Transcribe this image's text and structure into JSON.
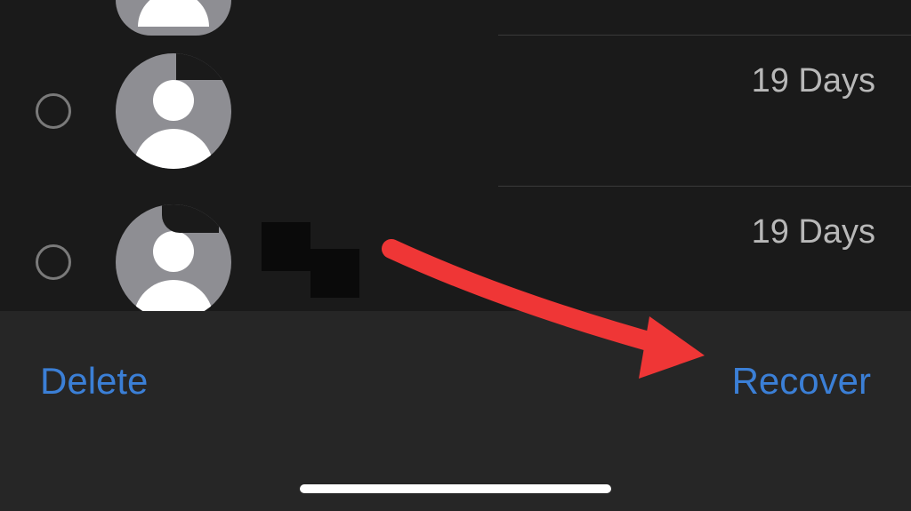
{
  "list": {
    "items": [
      {
        "days": ""
      },
      {
        "days": "19 Days"
      },
      {
        "days": "19 Days"
      }
    ]
  },
  "toolbar": {
    "delete_label": "Delete",
    "recover_label": "Recover"
  },
  "colors": {
    "link": "#3b7fd6",
    "background": "#1a1a1a",
    "toolbar_bg": "#262626",
    "avatar_bg": "#8e8e93",
    "days_text": "#b8b8b8",
    "arrow": "#ef3636"
  }
}
